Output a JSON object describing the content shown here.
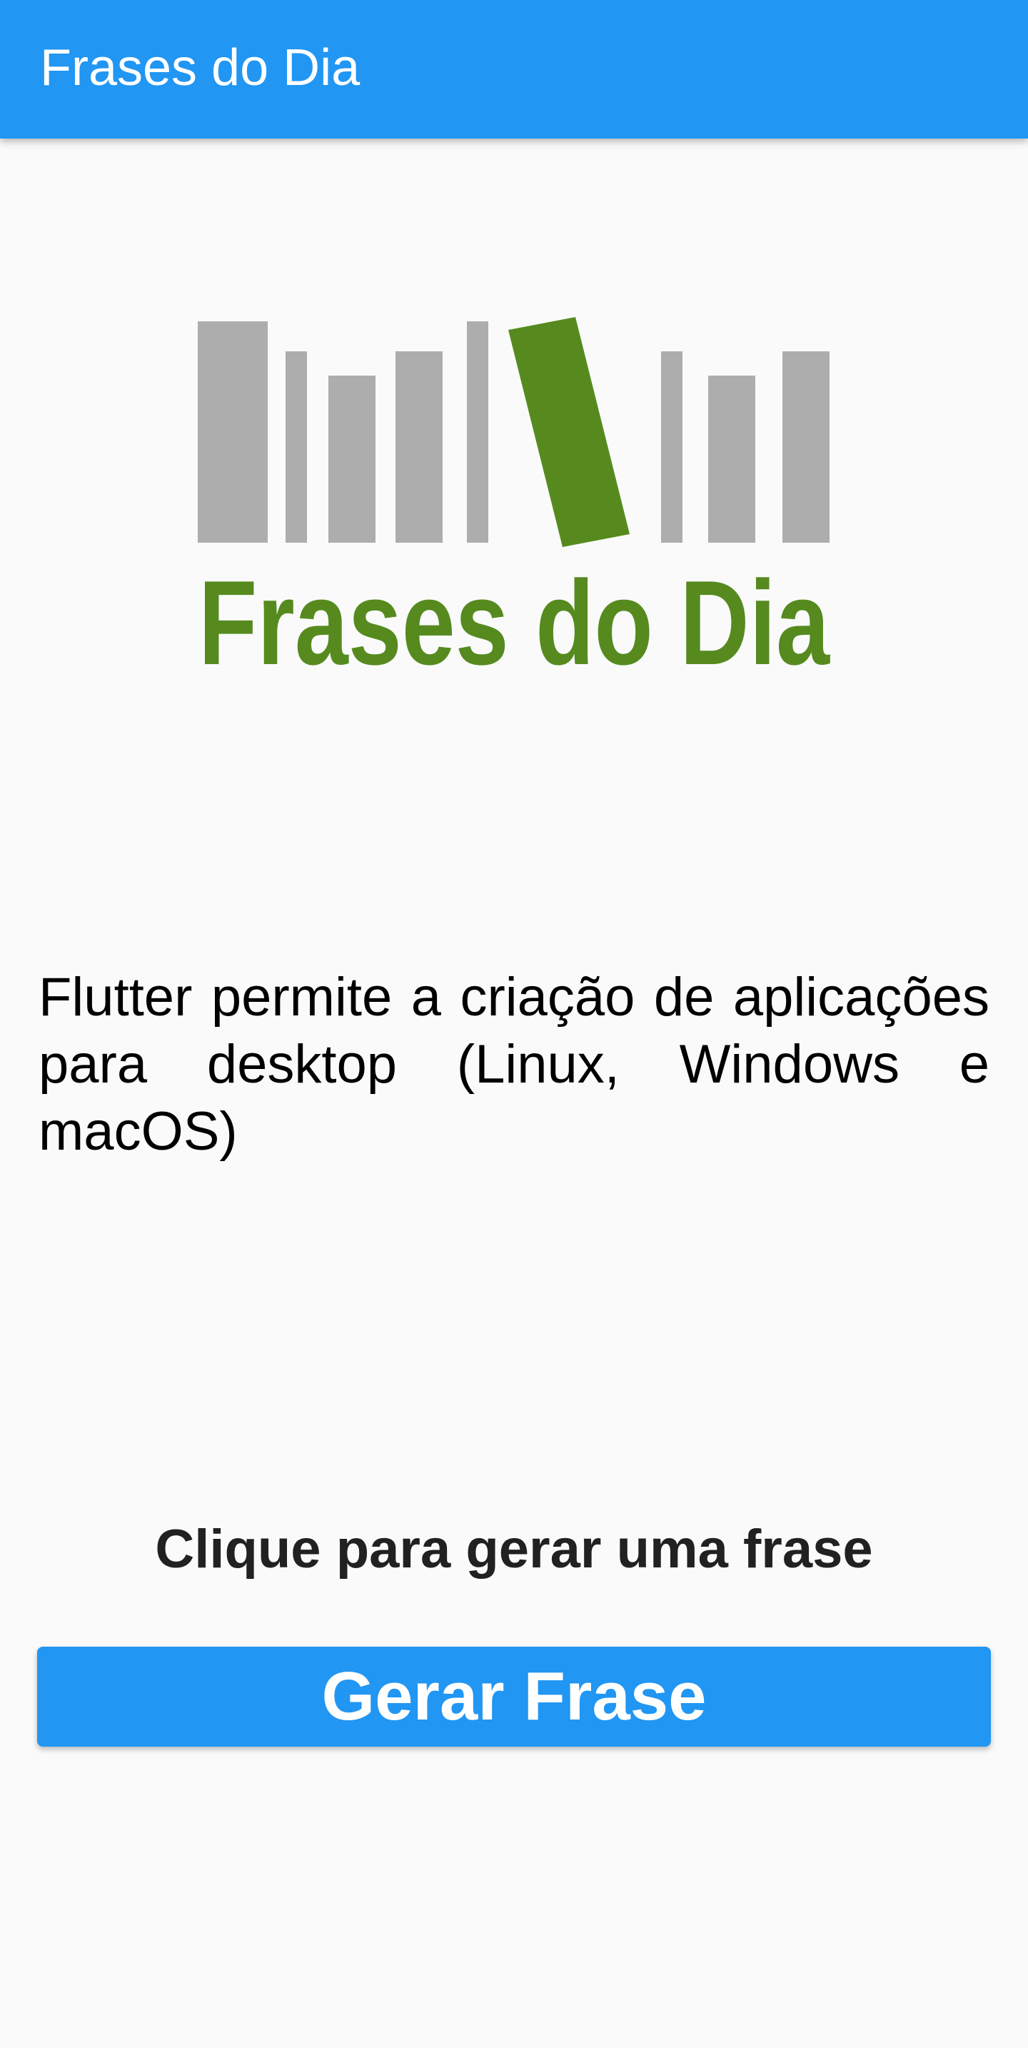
{
  "app_bar": {
    "title": "Frases do Dia",
    "color": "#2196f3"
  },
  "logo": {
    "text": "Frases do Dia",
    "text_color": "#568a1f",
    "bar_color": "#adadad",
    "accent_bar_color": "#568a1f"
  },
  "phrase": {
    "text": "Flutter permite a criação de aplicações para desktop (Linux, Windows e macOS)"
  },
  "prompt": {
    "text": "Clique para gerar uma frase"
  },
  "button": {
    "label": "Gerar Frase",
    "color": "#2196f3"
  }
}
